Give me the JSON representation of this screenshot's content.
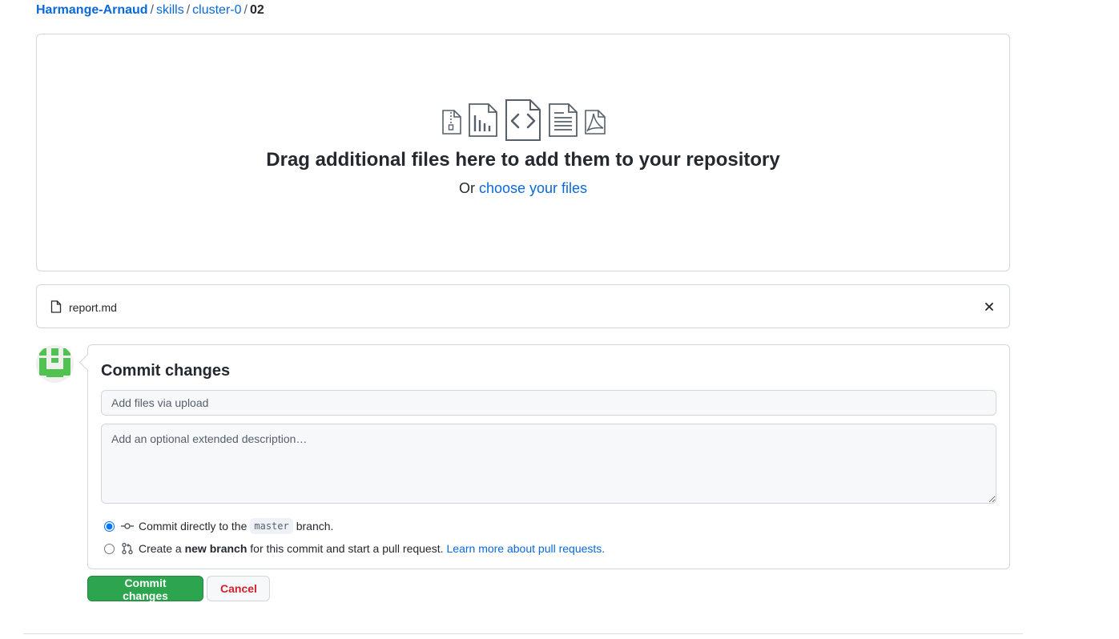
{
  "breadcrumb": {
    "owner": "Harmange-Arnaud",
    "repo": "skills",
    "folder": "cluster-0",
    "current": "02",
    "separator": "/"
  },
  "dropzone": {
    "title": "Drag additional files here to add them to your repository",
    "or_text": "Or",
    "choose_link": "choose your files",
    "icons": [
      "file-zip-icon",
      "file-chart-icon",
      "file-code-icon",
      "file-text-icon",
      "file-pdf-icon"
    ]
  },
  "files": [
    {
      "name": "report.md",
      "icon": "file-icon",
      "remove_icon": "close-icon"
    }
  ],
  "commit": {
    "title": "Commit changes",
    "summary_placeholder": "Add files via upload",
    "description_placeholder": "Add an optional extended description…",
    "option_direct": {
      "prefix": "Commit directly to the",
      "branch": "master",
      "suffix": "branch.",
      "checked": true
    },
    "option_new_branch": {
      "prefix": "Create a",
      "bold": "new branch",
      "suffix": "for this commit and start a pull request.",
      "link": "Learn more about pull requests.",
      "checked": false
    }
  },
  "actions": {
    "commit_label": "Commit changes",
    "cancel_label": "Cancel"
  },
  "colors": {
    "link": "#0969da",
    "primary_button": "#2da44e",
    "danger_text": "#cf222e",
    "avatar": "#4fc24f"
  }
}
